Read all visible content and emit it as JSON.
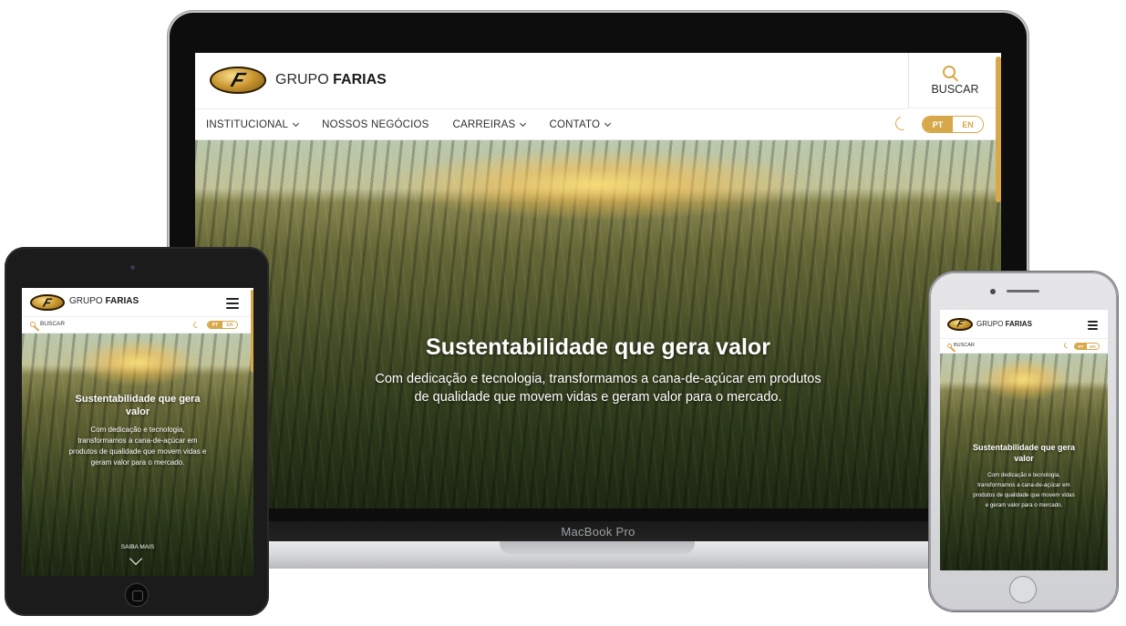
{
  "laptop": {
    "brand_light": "GRUPO ",
    "brand_bold": "FARIAS",
    "logo_letter": "F",
    "search_label": "BUSCAR",
    "nav": [
      {
        "label": "INSTITUCIONAL",
        "dropdown": true
      },
      {
        "label": "NOSSOS NEGÓCIOS",
        "dropdown": false
      },
      {
        "label": "CARREIRAS",
        "dropdown": true
      },
      {
        "label": "CONTATO",
        "dropdown": true
      }
    ],
    "lang_active": "PT",
    "lang_other": "EN",
    "hero_title": "Sustentabilidade que gera valor",
    "hero_text_1": "Com dedicação e tecnologia, transformamos a cana-de-açúcar em produtos",
    "hero_text_2": "de qualidade que movem vidas e geram valor para o mercado.",
    "device_label": "MacBook Pro"
  },
  "tablet": {
    "brand_light": "GRUPO ",
    "brand_bold": "FARIAS",
    "logo_letter": "F",
    "search_label": "BUSCAR",
    "lang_active": "PT",
    "lang_other": "EN",
    "hero_title_1": "Sustentabilidade que gera",
    "hero_title_2": "valor",
    "hero_text_1": "Com dedicação e tecnologia,",
    "hero_text_2": "transformamos a cana-de-açúcar em",
    "hero_text_3": "produtos de qualidade que movem vidas e",
    "hero_text_4": "geram valor para o mercado.",
    "cta": "SAIBA MAIS"
  },
  "phone": {
    "brand_light": "GRUPO ",
    "brand_bold": "FARIAS",
    "logo_letter": "F",
    "search_label": "BUSCAR",
    "lang_active": "PT",
    "lang_other": "EN",
    "hero_title_1": "Sustentabilidade que gera",
    "hero_title_2": "valor",
    "hero_text_1": "Com dedicação e tecnologia,",
    "hero_text_2": "transformamos a cana-de-açúcar em",
    "hero_text_3": "produtos de qualidade que movem vidas",
    "hero_text_4": "e geram valor para o mercado."
  },
  "colors": {
    "accent": "#d6a84a",
    "header_bg": "#ffffff",
    "hero_text": "#ffffff"
  }
}
